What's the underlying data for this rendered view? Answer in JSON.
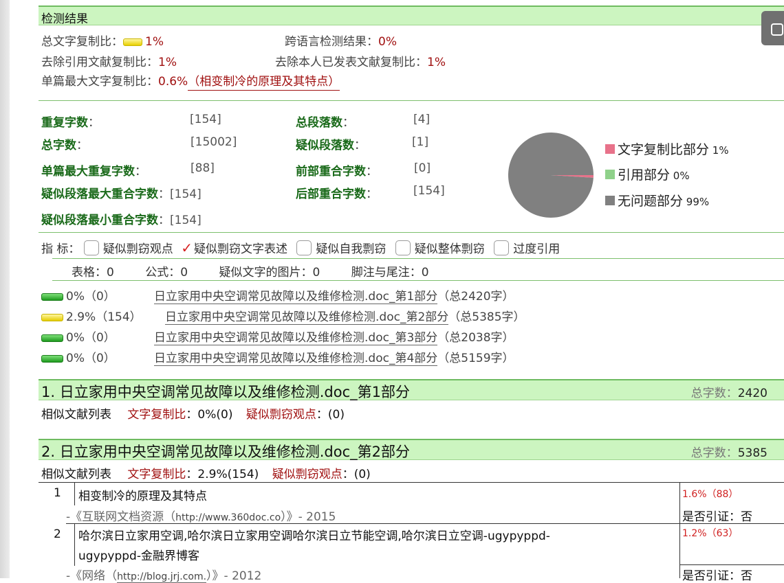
{
  "header": {
    "title": "检测结果"
  },
  "summary": {
    "total_copy_label": "总文字复制比：",
    "total_copy_value": "1%",
    "cross_lang_label": "跨语言检测结果：",
    "cross_lang_value": "0%",
    "exclude_ref_label": "去除引用文献复制比：",
    "exclude_ref_value": "1%",
    "exclude_self_label": "去除本人已发表文献复制比：",
    "exclude_self_value": "1%",
    "max_single_label": "单篇最大文字复制比：",
    "max_single_value": "0.6%",
    "max_single_source": "（相变制冷的原理及其特点）"
  },
  "stats": {
    "dup_chars_label": "重复字数",
    "dup_chars_value": "[154]",
    "total_chars_label": "总字数",
    "total_chars_value": "[15002]",
    "max_single_dup_label": "单篇最大重复字数",
    "max_single_dup_value": "[88]",
    "susp_para_max_label": "疑似段落最大重合字数",
    "susp_para_max_value": "[154]",
    "susp_para_min_label": "疑似段落最小重合字数",
    "susp_para_min_value": "[154]",
    "total_para_label": "总段落数",
    "total_para_value": "[4]",
    "susp_para_label": "疑似段落数",
    "susp_para_value": "[1]",
    "front_overlap_label": "前部重合字数",
    "front_overlap_value": "[0]",
    "back_overlap_label": "后部重合字数",
    "back_overlap_value": "[154]",
    "colon": "："
  },
  "chart_data": {
    "type": "pie",
    "slices": [
      {
        "label": "文字复制比部分",
        "value": 1,
        "display": "1%",
        "color": "#e8728a"
      },
      {
        "label": "引用部分",
        "value": 0,
        "display": "0%",
        "color": "#8fd18a"
      },
      {
        "label": "无问题部分",
        "value": 99,
        "display": "99%",
        "color": "#808080"
      }
    ]
  },
  "indicators": {
    "label": "指  标：",
    "items": [
      {
        "label": "疑似剽窃观点",
        "checked": false
      },
      {
        "label": "疑似剽窃文字表述",
        "checked": true
      },
      {
        "label": "疑似自我剽窃",
        "checked": false
      },
      {
        "label": "疑似整体剽窃",
        "checked": false
      },
      {
        "label": "过度引用",
        "checked": false
      }
    ],
    "check_mark": "✓"
  },
  "counts": {
    "table_label": "表格：",
    "table_value": "0",
    "formula_label": "公式：",
    "formula_value": "0",
    "image_label": "疑似文字的图片：",
    "image_value": "0",
    "footnote_label": "脚注与尾注：",
    "footnote_value": "0"
  },
  "parts": [
    {
      "pct": "0%（0）",
      "name": "日立家用中央空调常见故障以及维修检测.doc_第1部分",
      "total": "（总2420字）"
    },
    {
      "pct": "2.9%（154）",
      "name": "日立家用中央空调常见故障以及维修检测.doc_第2部分",
      "total": "（总5385字）"
    },
    {
      "pct": "0%（0）",
      "name": "日立家用中央空调常见故障以及维修检测.doc_第3部分",
      "total": "（总2038字）"
    },
    {
      "pct": "0%（0）",
      "name": "日立家用中央空调常见故障以及维修检测.doc_第4部分",
      "total": "（总5159字）"
    }
  ],
  "section1": {
    "title": "1. 日立家用中央空调常见故障以及维修检测.doc_第1部分",
    "total_label": "总字数：",
    "total_value": "2420",
    "list_label": "相似文献列表",
    "copy_label": "文字复制比",
    "copy_value": "：0%(0)",
    "idea_label": "疑似剽窃观点",
    "idea_value": "：(0)"
  },
  "section2": {
    "title": "2. 日立家用中央空调常见故障以及维修检测.doc_第2部分",
    "total_label": "总字数：",
    "total_value": "5385",
    "list_label": "相似文献列表",
    "copy_label": "文字复制比",
    "copy_value": "：2.9%(154)",
    "idea_label": "疑似剽窃观点",
    "idea_value": "：(0)"
  },
  "refs": [
    {
      "num": "1",
      "title": "相变制冷的原理及其特点",
      "title2": "",
      "src_pre": "-《互联网文档资源（",
      "src_url": "http://www.360doc.co",
      "src_post": "）》- 2015",
      "pct": "1.6%（88）",
      "cite": "是否引证：否"
    },
    {
      "num": "2",
      "title": "哈尔滨日立家用空调,哈尔滨日立家用空调哈尔滨日立节能空调,哈尔滨日立空调-ugypyppd-",
      "title2": "ugypyppd-金融界博客",
      "src_pre": "-《网络（",
      "src_url": "http://blog.jrj.com.",
      "src_post": "）》- 2012",
      "pct": "1.2%（63）",
      "cite": "是否引证：否"
    }
  ]
}
